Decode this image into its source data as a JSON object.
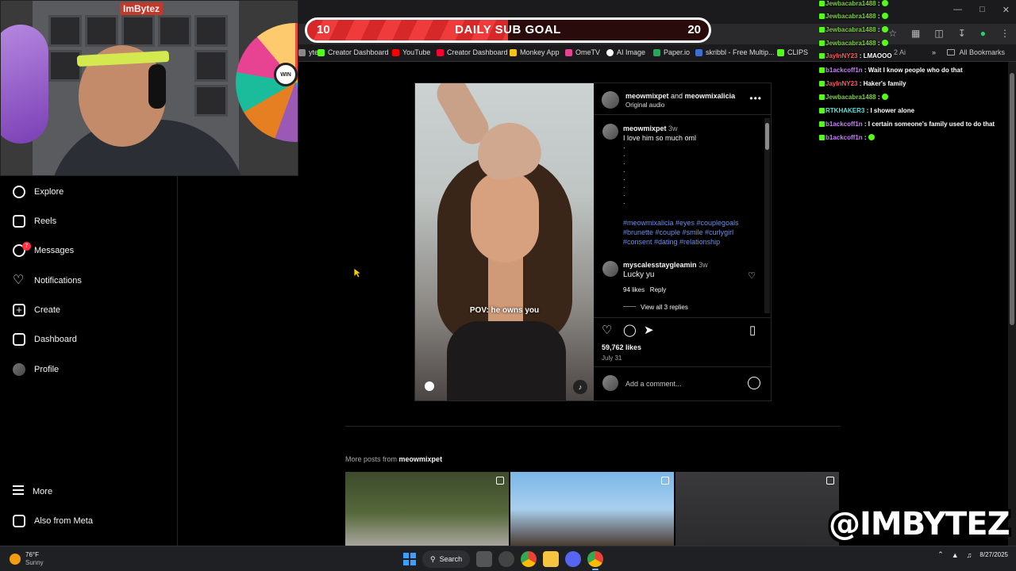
{
  "browser": {
    "bookmarks": [
      {
        "label": "ytez",
        "color": "#888888"
      },
      {
        "label": "Creator Dashboard",
        "color": "#53fc18"
      },
      {
        "label": "YouTube",
        "color": "#ff0000"
      },
      {
        "label": "Creator Dashboard",
        "color": "#ff0033"
      },
      {
        "label": "Monkey App",
        "color": "#f5c518"
      },
      {
        "label": "OmeTV",
        "color": "#e84393"
      },
      {
        "label": "AI Image",
        "color": "#ffffff"
      },
      {
        "label": "Paper.io",
        "color": "#22aa55"
      },
      {
        "label": "skribbl - Free Multip...",
        "color": "#3b6fd4"
      },
      {
        "label": "CLIPS",
        "color": "#53fc18"
      },
      {
        "label": "2 Ai",
        "color": "#777777"
      }
    ],
    "all_bookmarks": "All Bookmarks"
  },
  "webcam": {
    "name": "ImBytez",
    "wheel_label": "WIN"
  },
  "goal": {
    "current": "10",
    "title": "DAILY SUB GOAL",
    "target": "20",
    "progress": 0.5
  },
  "sidebar": {
    "items": [
      {
        "label": "Explore",
        "icon": "compass-icon"
      },
      {
        "label": "Reels",
        "icon": "reels-icon"
      },
      {
        "label": "Messages",
        "icon": "messenger-icon",
        "badge": "7"
      },
      {
        "label": "Notifications",
        "icon": "heart-icon"
      },
      {
        "label": "Create",
        "icon": "plus-square-icon"
      },
      {
        "label": "Dashboard",
        "icon": "chart-icon"
      },
      {
        "label": "Profile",
        "icon": "avatar"
      }
    ],
    "more": "More",
    "also_from_meta": "Also from Meta"
  },
  "post": {
    "author1": "meowmixpet",
    "and": "and",
    "author2": "meowmixalicia",
    "audio": "Original audio",
    "overlay_caption": "POV: he owns you",
    "caption_user": "meowmixpet",
    "caption_time": "3w",
    "caption_text": "I love him so much oml",
    "hashtags": "#meowmixalicia #eyes #couplegoals #brunette #couple #smile #curlygirl #consent #dating #relationship",
    "comment_user": "myscalesstaygleamin",
    "comment_time": "3w",
    "comment_text": "Lucky yu",
    "comment_likes": "94 likes",
    "comment_reply": "Reply",
    "view_replies": "View all 3 replies",
    "likes": "59,762 likes",
    "date": "July 31",
    "add_comment_placeholder": "Add a comment..."
  },
  "more_posts": {
    "prefix": "More posts from",
    "user": "meowmixpet"
  },
  "chat": [
    {
      "user": "Jewbacabra1488",
      "msg": "",
      "color": "#7fcf3c"
    },
    {
      "user": "Jewbacabra1488",
      "msg": "",
      "color": "#7fcf3c"
    },
    {
      "user": "Jewbacabra1488",
      "msg": "",
      "color": "#7fcf3c"
    },
    {
      "user": "Jewbacabra1488",
      "msg": "",
      "color": "#7fcf3c"
    },
    {
      "user": "JaylnNY23",
      "msg": "LMAOOO",
      "color": "#ff5a5a"
    },
    {
      "user": "b1ackcoff1n",
      "msg": "Wait I know people who do that",
      "color": "#c77dff"
    },
    {
      "user": "JaylnNY23",
      "msg": "Haker's family",
      "color": "#ff5a5a"
    },
    {
      "user": "Jewbacabra1488",
      "msg": "",
      "color": "#7fcf3c"
    },
    {
      "user": "RTKHAKER3",
      "msg": "I shower alone",
      "color": "#5ee0d8"
    },
    {
      "user": "b1ackcoff1n",
      "msg": "I certain someone's family used to do that",
      "color": "#c77dff"
    },
    {
      "user": "b1ackcoff1n",
      "msg": "",
      "color": "#c77dff"
    }
  ],
  "watermark": "@IMBYTEZ",
  "taskbar": {
    "temp": "76°F",
    "condition": "Sunny",
    "search": "Search",
    "date": "8/27/2025"
  },
  "colors": {
    "ig_bg": "#000000",
    "link_blue": "#6e8fe8",
    "goal_red": "#d62828",
    "badge_red": "#ff3040"
  }
}
